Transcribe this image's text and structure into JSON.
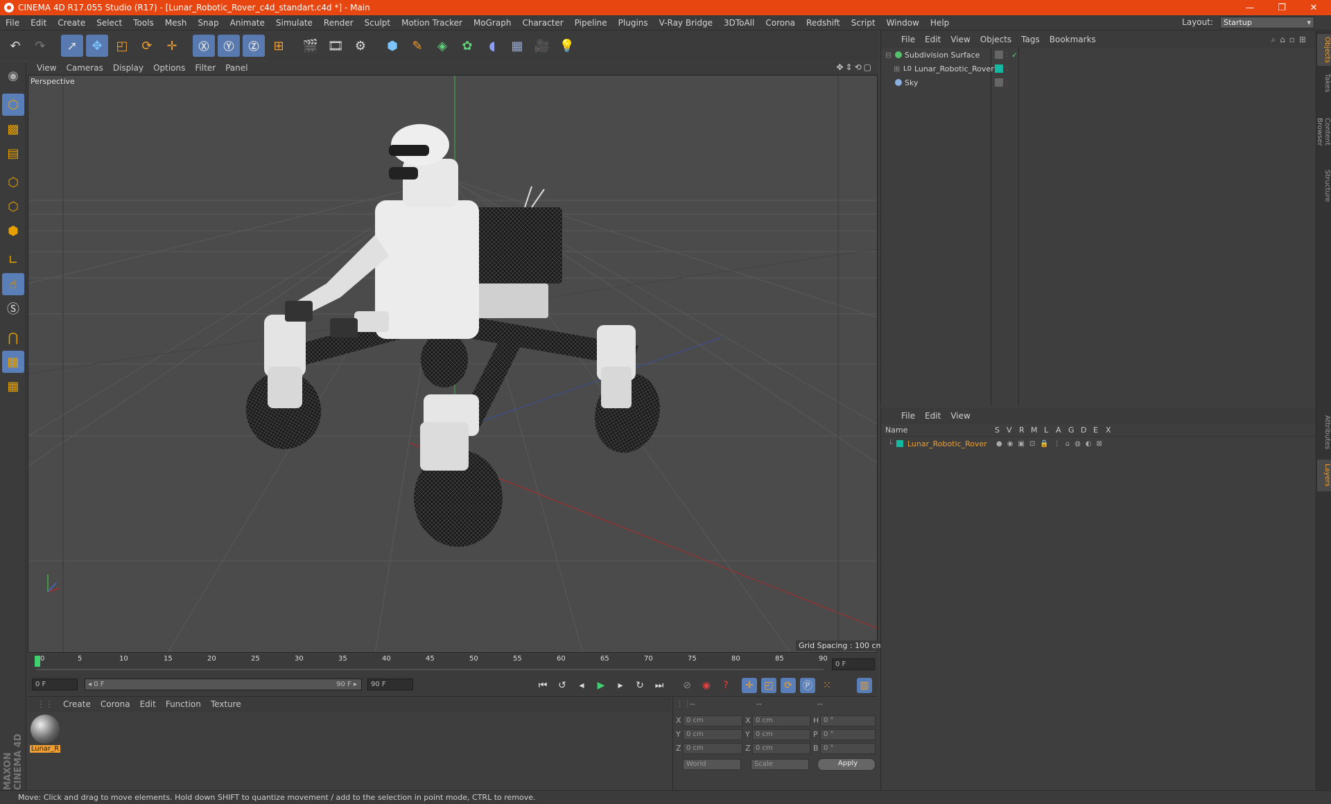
{
  "window": {
    "title": "CINEMA 4D R17.055 Studio (R17) - [Lunar_Robotic_Rover_c4d_standart.c4d *] - Main",
    "minimize": "—",
    "restore": "❐",
    "close": "✕"
  },
  "menubar": {
    "items": [
      "File",
      "Edit",
      "Create",
      "Select",
      "Tools",
      "Mesh",
      "Snap",
      "Animate",
      "Simulate",
      "Render",
      "Sculpt",
      "Motion Tracker",
      "MoGraph",
      "Character",
      "Pipeline",
      "Plugins",
      "V-Ray Bridge",
      "3DToAll",
      "Corona",
      "Redshift",
      "Script",
      "Window",
      "Help"
    ],
    "layout_label": "Layout:",
    "layout_value": "Startup"
  },
  "viewport": {
    "menu": [
      "View",
      "Cameras",
      "Display",
      "Options",
      "Filter",
      "Panel"
    ],
    "label": "Perspective",
    "grid_spacing": "Grid Spacing : 100 cm"
  },
  "timeline": {
    "ticks": [
      "0",
      "5",
      "10",
      "15",
      "20",
      "25",
      "30",
      "35",
      "40",
      "45",
      "50",
      "55",
      "60",
      "65",
      "70",
      "75",
      "80",
      "85",
      "90"
    ],
    "frame_end_field": "0 F"
  },
  "transport": {
    "start": "0 F",
    "range_start": "◂ 0 F",
    "range_end": "90 F ▸",
    "end": "90 F"
  },
  "materials": {
    "menu": [
      "Create",
      "Corona",
      "Edit",
      "Function",
      "Texture"
    ],
    "item_label": "Lunar_R"
  },
  "coords": {
    "header": [
      "--",
      "--",
      "--"
    ],
    "rows": [
      {
        "a": "X",
        "av": "0 cm",
        "b": "X",
        "bv": "0 cm",
        "c": "H",
        "cv": "0 °"
      },
      {
        "a": "Y",
        "av": "0 cm",
        "b": "Y",
        "bv": "0 cm",
        "c": "P",
        "cv": "0 °"
      },
      {
        "a": "Z",
        "av": "0 cm",
        "b": "Z",
        "bv": "0 cm",
        "c": "B",
        "cv": "0 °"
      }
    ],
    "world": "World",
    "scale": "Scale",
    "apply": "Apply"
  },
  "objects": {
    "menu": [
      "File",
      "Edit",
      "View",
      "Objects",
      "Tags",
      "Bookmarks"
    ],
    "items": [
      {
        "name": "Subdivision Surface",
        "color": "#55c070"
      },
      {
        "name": "Lunar_Robotic_Rover",
        "color": "#14b8a0"
      },
      {
        "name": "Sky",
        "color": "#8ab0e0"
      }
    ]
  },
  "layers": {
    "menu": [
      "File",
      "Edit",
      "View"
    ],
    "columns": [
      "Name",
      "S",
      "V",
      "R",
      "M",
      "L",
      "A",
      "G",
      "D",
      "E",
      "X"
    ],
    "row": {
      "name": "Lunar_Robotic_Rover",
      "color": "#14b8a0"
    }
  },
  "righttabs": [
    "Objects",
    "Takes",
    "Content Browser",
    "Structure",
    "Attributes",
    "Layers"
  ],
  "status": "Move: Click and drag to move elements. Hold down SHIFT to quantize movement / add to the selection in point mode, CTRL to remove.",
  "brand": "MAXON CINEMA 4D"
}
